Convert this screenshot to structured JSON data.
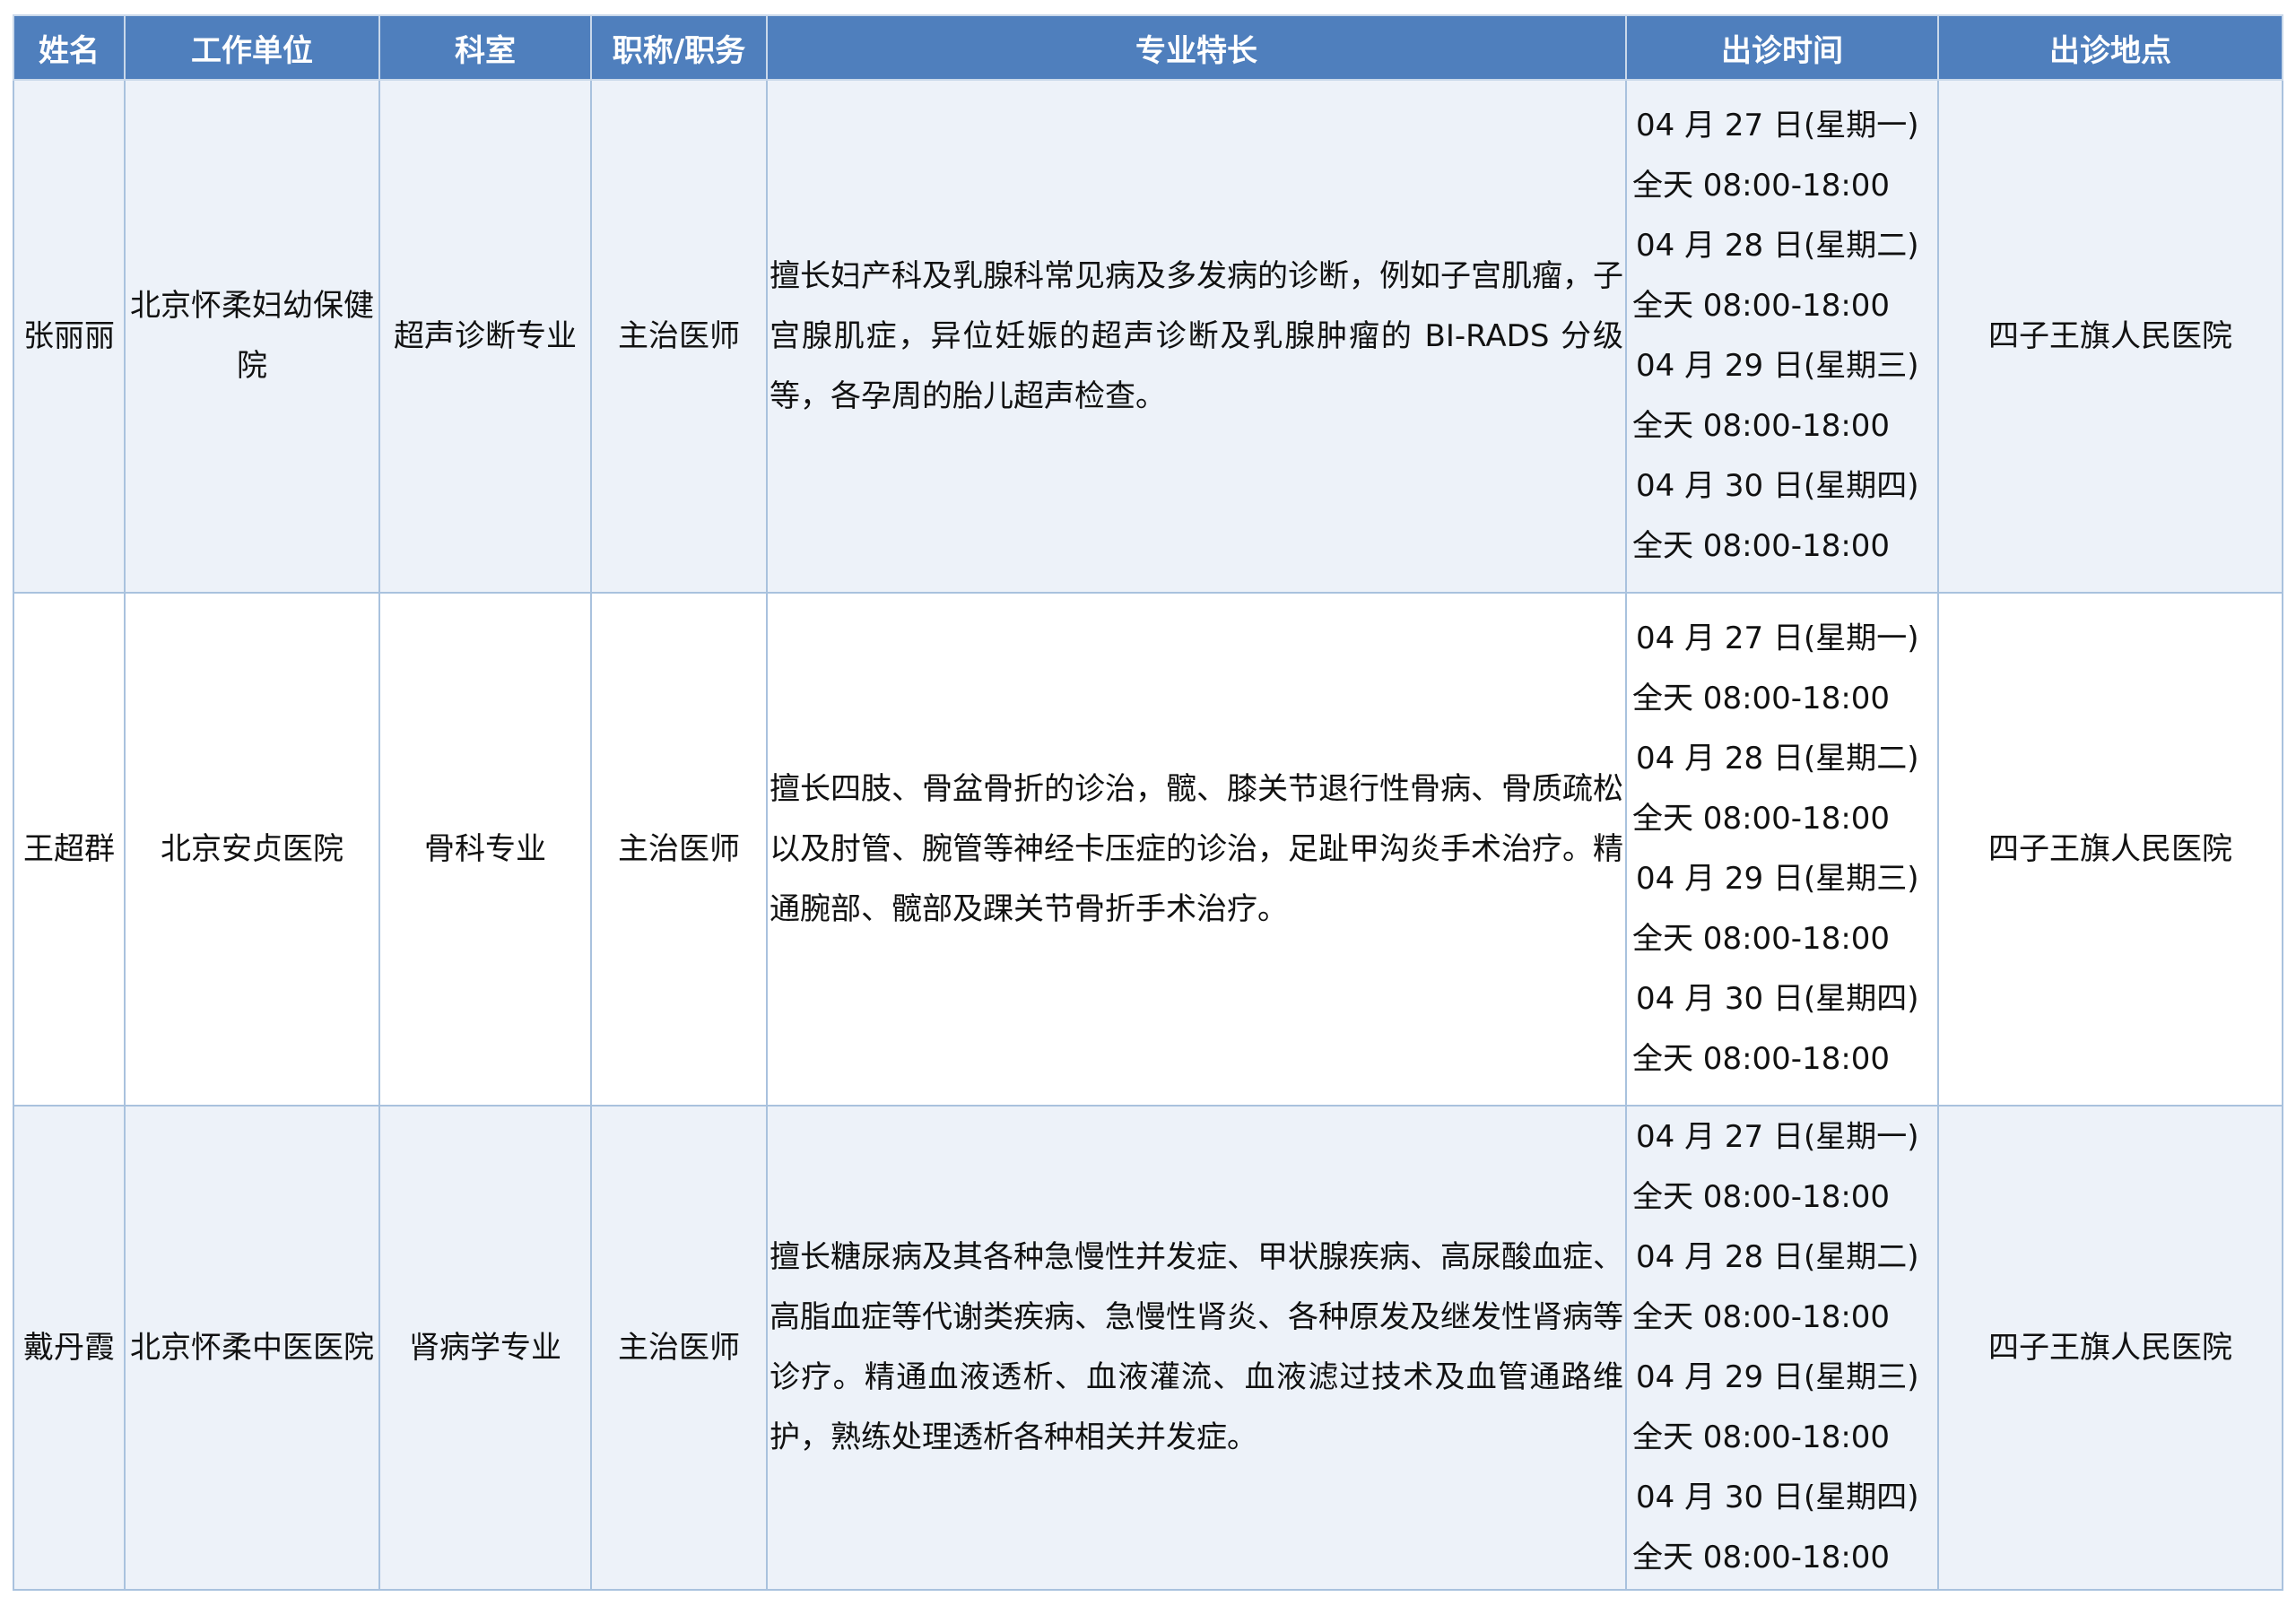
{
  "headers": [
    "姓名",
    "工作单位",
    "科室",
    "职称/职务",
    "专业特长",
    "出诊时间",
    "出诊地点"
  ],
  "rows": [
    {
      "name": "张丽丽",
      "unit": "北京怀柔妇幼保健院",
      "dept": "超声诊断专业",
      "title": "主治医师",
      "specialty": "擅长妇产科及乳腺科常见病及多发病的诊断，例如子宫肌瘤，子宫腺肌症，异位妊娠的超声诊断及乳腺肿瘤的 BI-RADS 分级等，各孕周的胎儿超声检查。",
      "schedule": [
        "04 月 27 日(星期一)",
        "全天 08:00-18:00",
        "04 月 28 日(星期二)",
        "全天 08:00-18:00",
        "04 月 29 日(星期三)",
        "全天 08:00-18:00",
        "04 月 30 日(星期四)",
        "全天 08:00-18:00"
      ],
      "location": "四子王旗人民医院"
    },
    {
      "name": "王超群",
      "unit": "北京安贞医院",
      "dept": "骨科专业",
      "title": "主治医师",
      "specialty": "擅长四肢、骨盆骨折的诊治，髋、膝关节退行性骨病、骨质疏松以及肘管、腕管等神经卡压症的诊治，足趾甲沟炎手术治疗。精通腕部、髋部及踝关节骨折手术治疗。",
      "schedule": [
        "04 月 27 日(星期一)",
        "全天 08:00-18:00",
        "04 月 28 日(星期二)",
        "全天 08:00-18:00",
        "04 月 29 日(星期三)",
        "全天 08:00-18:00",
        "04 月 30 日(星期四)",
        "全天 08:00-18:00"
      ],
      "location": "四子王旗人民医院"
    },
    {
      "name": "戴丹霞",
      "unit": "北京怀柔中医医院",
      "dept": "肾病学专业",
      "title": "主治医师",
      "specialty": "擅长糖尿病及其各种急慢性并发症、甲状腺疾病、高尿酸血症、高脂血症等代谢类疾病、急慢性肾炎、各种原发及继发性肾病等诊疗。精通血液透析、血液灌流、血液滤过技术及血管通路维护，熟练处理透析各种相关并发症。",
      "schedule": [
        "04 月 27 日(星期一)",
        "全天 08:00-18:00",
        "04 月 28 日(星期二)",
        "全天 08:00-18:00",
        "04 月 29 日(星期三)",
        "全天 08:00-18:00",
        "04 月 30 日(星期四)",
        "全天 08:00-18:00"
      ],
      "location": "四子王旗人民医院"
    }
  ]
}
